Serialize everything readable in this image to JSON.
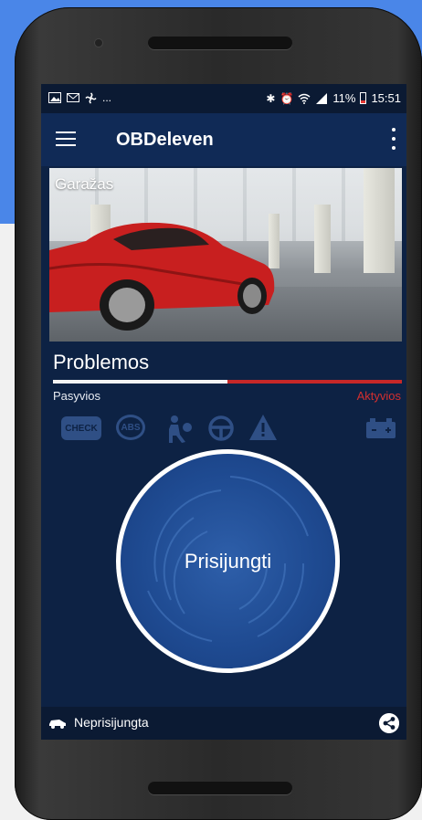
{
  "statusbar": {
    "left_icons": [
      "image-icon",
      "mail-icon",
      "fan-icon"
    ],
    "ellipsis": "...",
    "battery_percent": "11%",
    "time": "15:51"
  },
  "appbar": {
    "title": "OBDeleven"
  },
  "garage": {
    "label": "Garažas"
  },
  "problems": {
    "title": "Problemos",
    "passive_label": "Pasyvios",
    "active_label": "Aktyvios",
    "passive_fraction": 0.5
  },
  "dashboard_icons": {
    "check_label": "CHECK",
    "abs_label": "ABS"
  },
  "connect": {
    "label": "Prisijungti"
  },
  "bottombar": {
    "status": "Neprisijungta"
  },
  "colors": {
    "accent_red": "#d32f2f",
    "screen_blue": "#0d2244",
    "ring": "#ffffff"
  }
}
